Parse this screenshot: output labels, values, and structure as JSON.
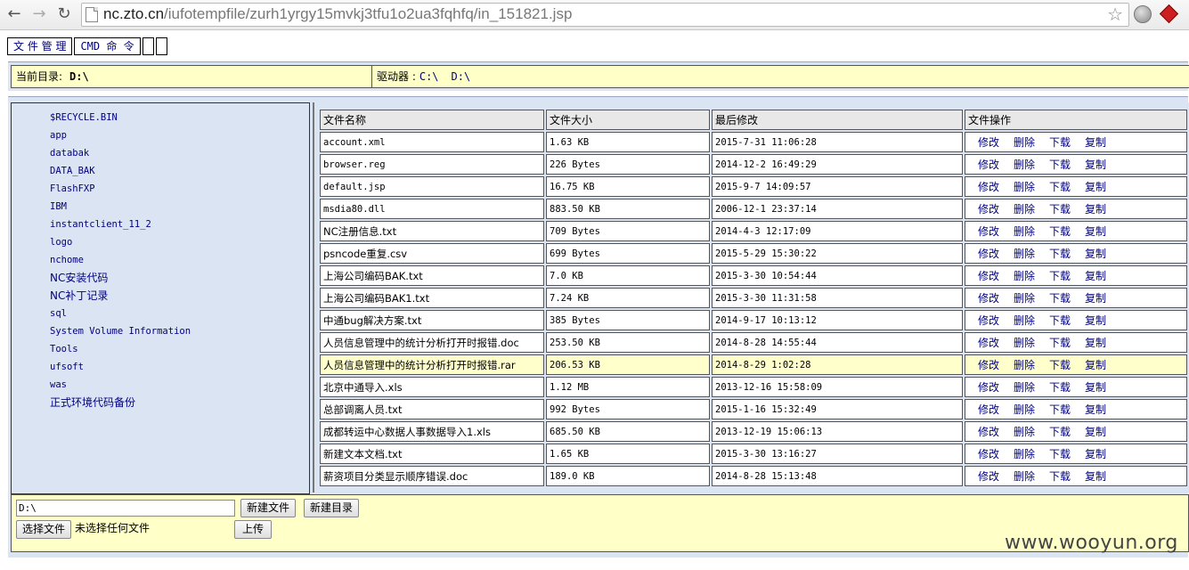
{
  "browser": {
    "url_host": "nc.zto.cn",
    "url_path": "/iufotempfile/zurh1yrgy15mvkj3tfu1o2ua3fqhfq/in_151821.jsp",
    "icons": [
      "back-icon",
      "forward-icon",
      "reload-icon",
      "page-icon",
      "bookmark-star-icon",
      "globe-icon",
      "extension-icon"
    ]
  },
  "menu": {
    "file_manager": "文 件 管 理",
    "cmd": "CMD 命 令"
  },
  "pathbar": {
    "current_label": "当前目录:",
    "current_value": "D:\\",
    "drives_label": "驱动器 :",
    "drives": [
      "C:\\",
      "D:\\"
    ]
  },
  "sidebar": {
    "items": [
      "$RECYCLE.BIN",
      "app",
      "databak",
      "DATA_BAK",
      "FlashFXP",
      "IBM",
      "instantclient_11_2",
      "logo",
      "nchome",
      "NC安装代码",
      "NC补丁记录",
      "sql",
      "System Volume Information",
      "Tools",
      "ufsoft",
      "was",
      "正式环境代码备份"
    ]
  },
  "table": {
    "headers": [
      "文件名称",
      "文件大小",
      "最后修改",
      "文件操作"
    ],
    "actions": [
      "修改",
      "删除",
      "下载",
      "复制"
    ],
    "highlight_row": 10,
    "rows": [
      {
        "name": "account.xml",
        "size": "1.63 KB",
        "modified": "2015-7-31 11:06:28"
      },
      {
        "name": "browser.reg",
        "size": "226 Bytes",
        "modified": "2014-12-2 16:49:29"
      },
      {
        "name": "default.jsp",
        "size": "16.75 KB",
        "modified": "2015-9-7 14:09:57"
      },
      {
        "name": "msdia80.dll",
        "size": "883.50 KB",
        "modified": "2006-12-1 23:37:14"
      },
      {
        "name": "NC注册信息.txt",
        "size": "709 Bytes",
        "modified": "2014-4-3 12:17:09"
      },
      {
        "name": "psncode重复.csv",
        "size": "699 Bytes",
        "modified": "2015-5-29 15:30:22"
      },
      {
        "name": "上海公司编码BAK.txt",
        "size": "7.0 KB",
        "modified": "2015-3-30 10:54:44"
      },
      {
        "name": "上海公司编码BAK1.txt",
        "size": "7.24 KB",
        "modified": "2015-3-30 11:31:58"
      },
      {
        "name": "中通bug解决方案.txt",
        "size": "385 Bytes",
        "modified": "2014-9-17 10:13:12"
      },
      {
        "name": "人员信息管理中的统计分析打开时报错.doc",
        "size": "253.50 KB",
        "modified": "2014-8-28 14:55:44"
      },
      {
        "name": "人员信息管理中的统计分析打开时报错.rar",
        "size": "206.53 KB",
        "modified": "2014-8-29 1:02:28"
      },
      {
        "name": "北京中通导入.xls",
        "size": "1.12 MB",
        "modified": "2013-12-16 15:58:09"
      },
      {
        "name": "总部调离人员.txt",
        "size": "992 Bytes",
        "modified": "2015-1-16 15:32:49"
      },
      {
        "name": "成都转运中心数据人事数据导入1.xls",
        "size": "685.50 KB",
        "modified": "2013-12-19 15:06:13"
      },
      {
        "name": "新建文本文档.txt",
        "size": "1.65 KB",
        "modified": "2015-3-30 13:16:27"
      },
      {
        "name": "薪资项目分类显示顺序错误.doc",
        "size": "189.0 KB",
        "modified": "2014-8-28 15:13:48"
      }
    ]
  },
  "upload": {
    "path_value": "D:\\",
    "new_file": "新建文件",
    "new_dir": "新建目录",
    "choose_file": "选择文件",
    "no_file": "未选择任何文件",
    "upload": "上传"
  },
  "watermark": "www.wooyun.org"
}
